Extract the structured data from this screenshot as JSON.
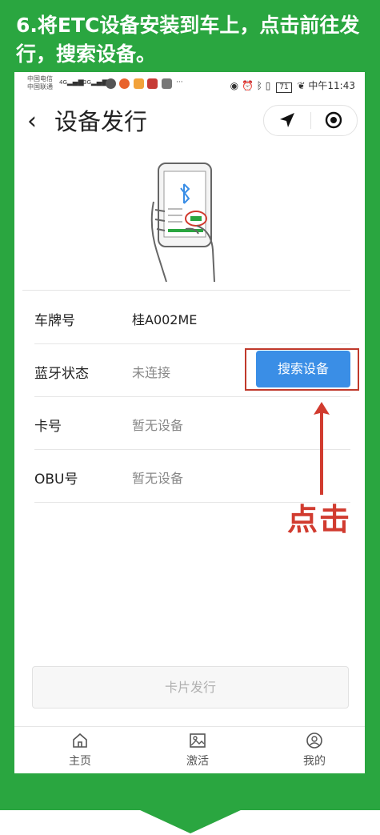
{
  "banner": {
    "text": "6.将ETC设备安装到车上，点击前往发行，搜索设备。"
  },
  "status_bar": {
    "carrier_1": "中国电信",
    "carrier_2": "中国联通",
    "signal_1": "4G",
    "signal_2": "3G",
    "battery": "71",
    "time": "中午11:43"
  },
  "nav": {
    "title": "设备发行"
  },
  "rows": [
    {
      "label": "车牌号",
      "value": "桂A002ME"
    },
    {
      "label": "蓝牙状态",
      "value": "未连接"
    },
    {
      "label": "卡号",
      "value": "暂无设备"
    },
    {
      "label": "OBU号",
      "value": "暂无设备"
    }
  ],
  "search_button": {
    "label": "搜索设备"
  },
  "annotation": {
    "label": "点击",
    "color": "#d13b2f"
  },
  "issue_button": {
    "label": "卡片发行"
  },
  "tabs": [
    {
      "label": "主页",
      "icon": "home-icon"
    },
    {
      "label": "激活",
      "icon": "image-icon"
    },
    {
      "label": "我的",
      "icon": "user-icon"
    }
  ],
  "colors": {
    "frame": "#2aa640",
    "primary": "#3a8ee6",
    "highlight": "#c0392b"
  }
}
